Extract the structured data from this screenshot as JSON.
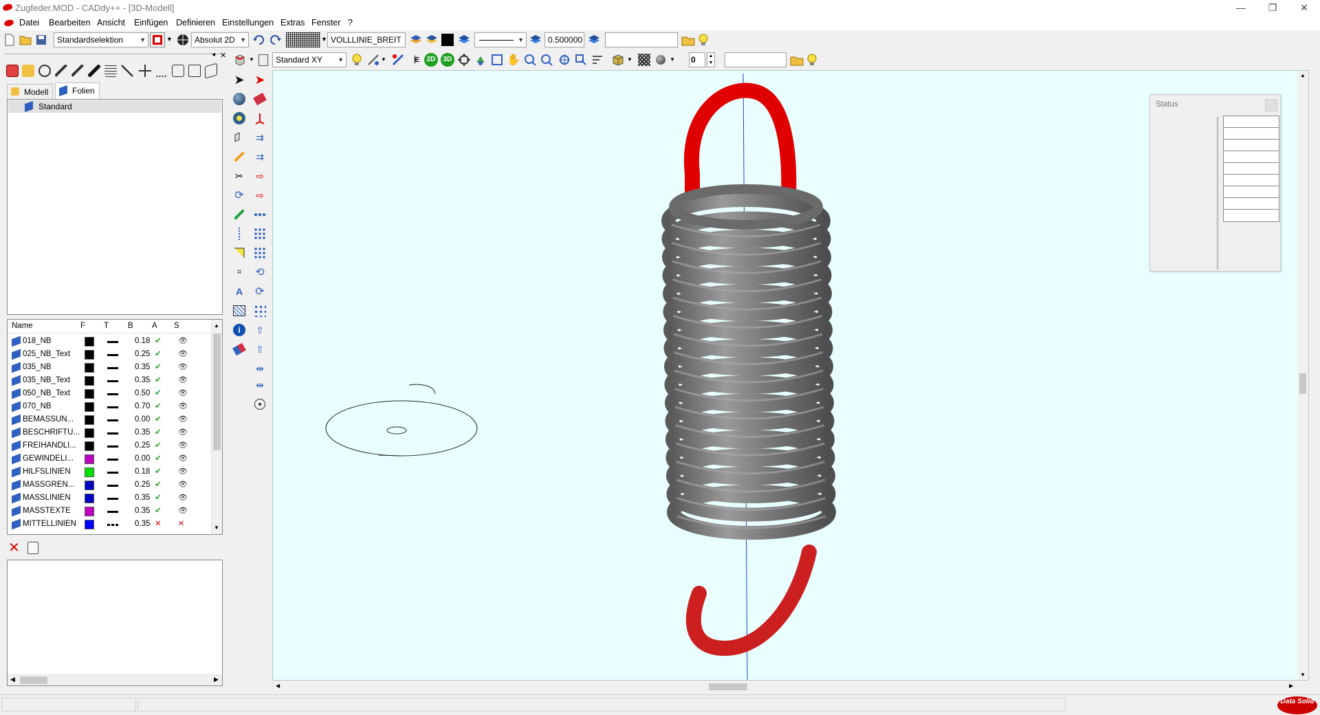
{
  "window": {
    "title": "Zugfeder.MOD  -  CADdy++ - [3D-Modell]",
    "controls": [
      "—",
      "❐",
      "✕"
    ]
  },
  "menu": [
    "Datei",
    "Bearbeiten",
    "Ansicht",
    "Einfügen",
    "Definieren",
    "Einstellungen",
    "Extras",
    "Fenster",
    "?"
  ],
  "mdi_controls": [
    "–",
    "❐",
    "✕"
  ],
  "toolbar1": {
    "selection_mode": "Standardselektion",
    "coord_mode": "Absolut 2D",
    "line_type": "VOLLLINIE_BREIT",
    "line_width": "0.500000",
    "layer_field": ""
  },
  "toolbar2": {
    "view": "Standard XY",
    "number_field": "0",
    "text_field": ""
  },
  "tabs": [
    {
      "label": "Modell",
      "active": false
    },
    {
      "label": "Folien",
      "active": true
    }
  ],
  "folien_tree": [
    "Standard"
  ],
  "layer_table": {
    "headers": [
      "Name",
      "F",
      "T",
      "B",
      "A",
      "S"
    ],
    "rows": [
      {
        "name": "018_NB",
        "color": "#000000",
        "width": "0.18",
        "active": true,
        "dashed": false
      },
      {
        "name": "025_NB_Text",
        "color": "#000000",
        "width": "0.25",
        "active": true,
        "dashed": false
      },
      {
        "name": "035_NB",
        "color": "#000000",
        "width": "0.35",
        "active": true,
        "dashed": false
      },
      {
        "name": "035_NB_Text",
        "color": "#000000",
        "width": "0.35",
        "active": true,
        "dashed": false
      },
      {
        "name": "050_NB_Text",
        "color": "#000000",
        "width": "0.50",
        "active": true,
        "dashed": false
      },
      {
        "name": "070_NB",
        "color": "#000000",
        "width": "0.70",
        "active": true,
        "dashed": false
      },
      {
        "name": "BEMASSUN...",
        "color": "#000000",
        "width": "0.00",
        "active": true,
        "dashed": false
      },
      {
        "name": "BESCHRIFTU...",
        "color": "#000000",
        "width": "0.35",
        "active": true,
        "dashed": false
      },
      {
        "name": "FREIHANDLI...",
        "color": "#000000",
        "width": "0.25",
        "active": true,
        "dashed": false
      },
      {
        "name": "GEWINDELI...",
        "color": "#c000c0",
        "width": "0.00",
        "active": true,
        "dashed": false
      },
      {
        "name": "HILFSLINIEN",
        "color": "#00e000",
        "width": "0.18",
        "active": true,
        "dashed": false
      },
      {
        "name": "MASSGREN...",
        "color": "#0000c0",
        "width": "0.25",
        "active": true,
        "dashed": false
      },
      {
        "name": "MASSLINIEN",
        "color": "#0000c0",
        "width": "0.35",
        "active": true,
        "dashed": false
      },
      {
        "name": "MASSTEXTE",
        "color": "#c000c0",
        "width": "0.35",
        "active": true,
        "dashed": false
      },
      {
        "name": "MITTELLINIEN",
        "color": "#0000ff",
        "width": "0.35",
        "active": false,
        "dashed": true
      }
    ]
  },
  "status_panel": {
    "title": "Status",
    "row_count": 9
  },
  "brand": "Data Solid",
  "colors": {
    "viewport_bg": "#e9ffff",
    "spring_gray": "#777777",
    "hook_red": "#e00000"
  }
}
